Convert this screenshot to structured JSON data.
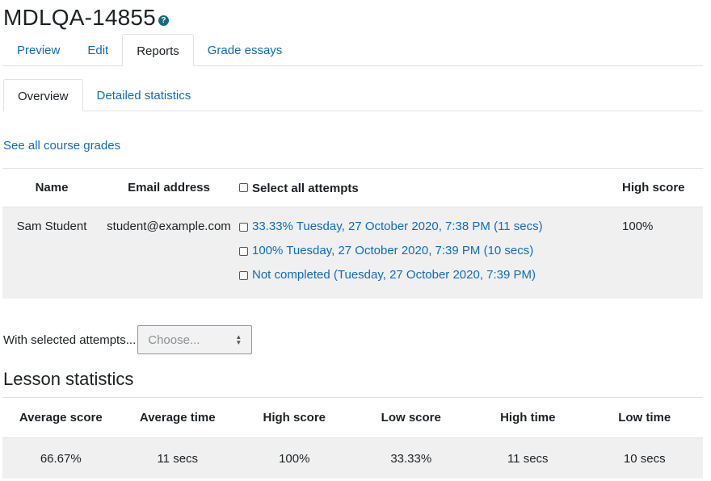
{
  "page": {
    "title": "MDLQA-14855",
    "help_icon": "question-circle-icon"
  },
  "primary_tabs": [
    {
      "label": "Preview",
      "active": false
    },
    {
      "label": "Edit",
      "active": false
    },
    {
      "label": "Reports",
      "active": true
    },
    {
      "label": "Grade essays",
      "active": false
    }
  ],
  "secondary_tabs": [
    {
      "label": "Overview",
      "active": true
    },
    {
      "label": "Detailed statistics",
      "active": false
    }
  ],
  "course_grades_link": "See all course grades",
  "attempts_table": {
    "headers": {
      "name": "Name",
      "email": "Email address",
      "select_all": "Select all attempts",
      "high_score": "High score"
    },
    "rows": [
      {
        "name": "Sam Student",
        "email": "student@example.com",
        "attempts": [
          "33.33% Tuesday, 27 October 2020, 7:38 PM (11 secs)",
          "100% Tuesday, 27 October 2020, 7:39 PM (10 secs)",
          "Not completed (Tuesday, 27 October 2020, 7:39 PM)"
        ],
        "high_score": "100%"
      }
    ]
  },
  "with_selected": {
    "label": "With selected attempts...",
    "select_value": "Choose..."
  },
  "lesson_statistics": {
    "title": "Lesson statistics",
    "headers": [
      "Average score",
      "Average time",
      "High score",
      "Low score",
      "High time",
      "Low time"
    ],
    "values": [
      "66.67%",
      "11 secs",
      "100%",
      "33.33%",
      "11 secs",
      "10 secs"
    ]
  }
}
